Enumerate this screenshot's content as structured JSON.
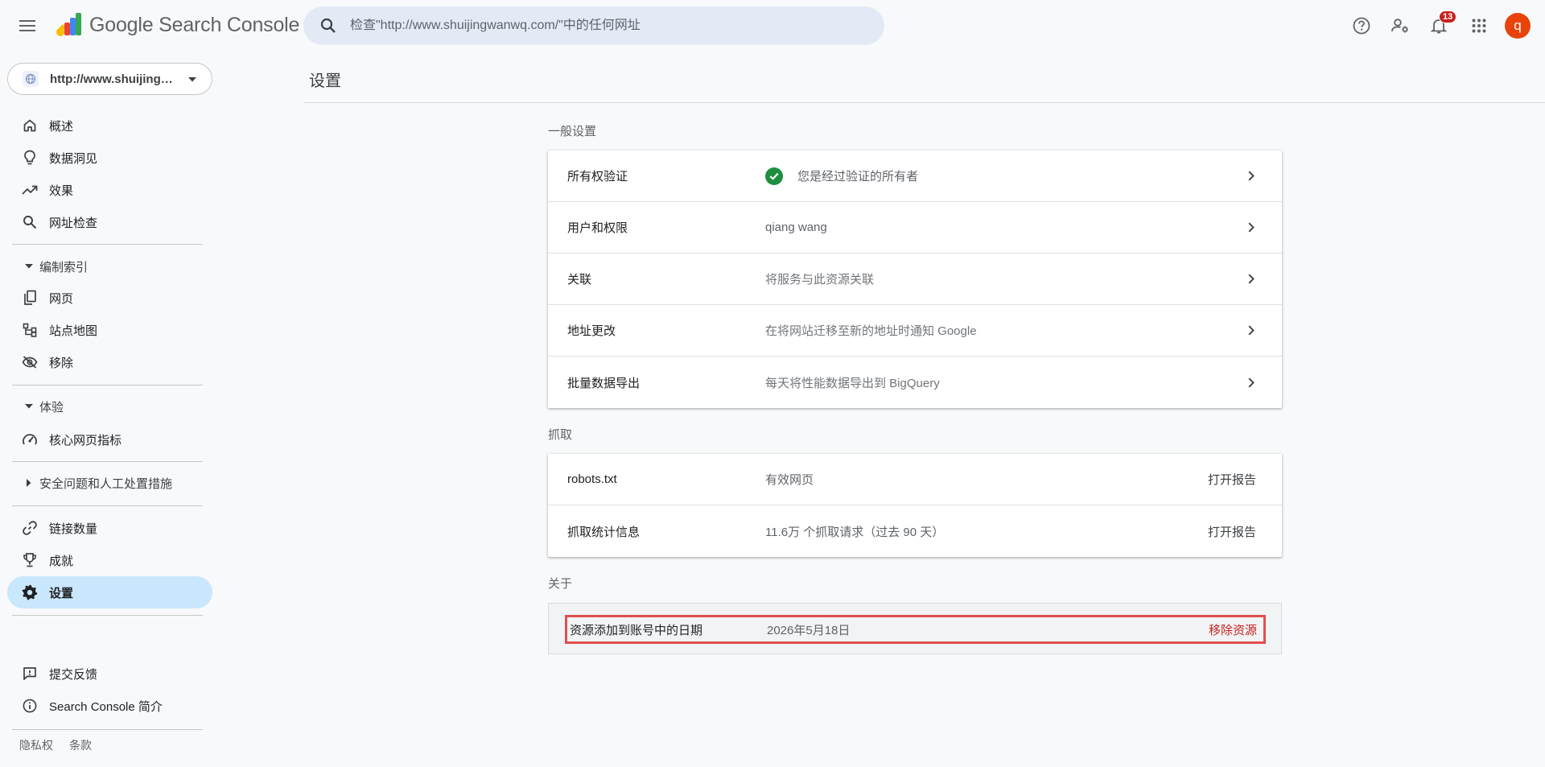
{
  "header": {
    "app_name": "Google Search Console",
    "search_placeholder": "检查\"http://www.shuijingwanwq.com/\"中的任何网址",
    "notification_count": "13",
    "avatar_letter": "q"
  },
  "sidebar": {
    "property": "http://www.shuijingwanwq.com/",
    "items": {
      "overview": "概述",
      "insights": "数据洞见",
      "performance": "效果",
      "url_inspection": "网址检查",
      "indexing": "编制索引",
      "pages": "网页",
      "sitemaps": "站点地图",
      "removals": "移除",
      "experience": "体验",
      "core_web_vitals": "核心网页指标",
      "security": "安全问题和人工处置措施",
      "links": "链接数量",
      "achievements": "成就",
      "settings": "设置",
      "feedback": "提交反馈",
      "about_sc": "Search Console 简介"
    },
    "footer": {
      "privacy": "隐私权",
      "terms": "条款"
    }
  },
  "main": {
    "title": "设置",
    "general": {
      "label": "一般设置",
      "ownership_label": "所有权验证",
      "ownership_value": "您是经过验证的所有者",
      "users_label": "用户和权限",
      "users_value": "qiang wang",
      "associations_label": "关联",
      "associations_value": "将服务与此资源关联",
      "change_address_label": "地址更改",
      "change_address_value": "在将网站迁移至新的地址时通知 Google",
      "bulk_export_label": "批量数据导出",
      "bulk_export_value": "每天将性能数据导出到 BigQuery"
    },
    "crawl": {
      "label": "抓取",
      "robots_label": "robots.txt",
      "robots_value": "有效网页",
      "robots_action": "打开报告",
      "stats_label": "抓取统计信息",
      "stats_value": "11.6万 个抓取请求（过去 90 天）",
      "stats_action": "打开报告"
    },
    "about": {
      "label": "关于",
      "added_label": "资源添加到账号中的日期",
      "added_value": "2026年5月18日",
      "remove_label": "移除资源"
    }
  },
  "colors": {
    "accent": "#1a73e8",
    "highlight_border": "#e04f4f",
    "remove": "#c5221f",
    "active_nav": "#c9e7fd"
  }
}
